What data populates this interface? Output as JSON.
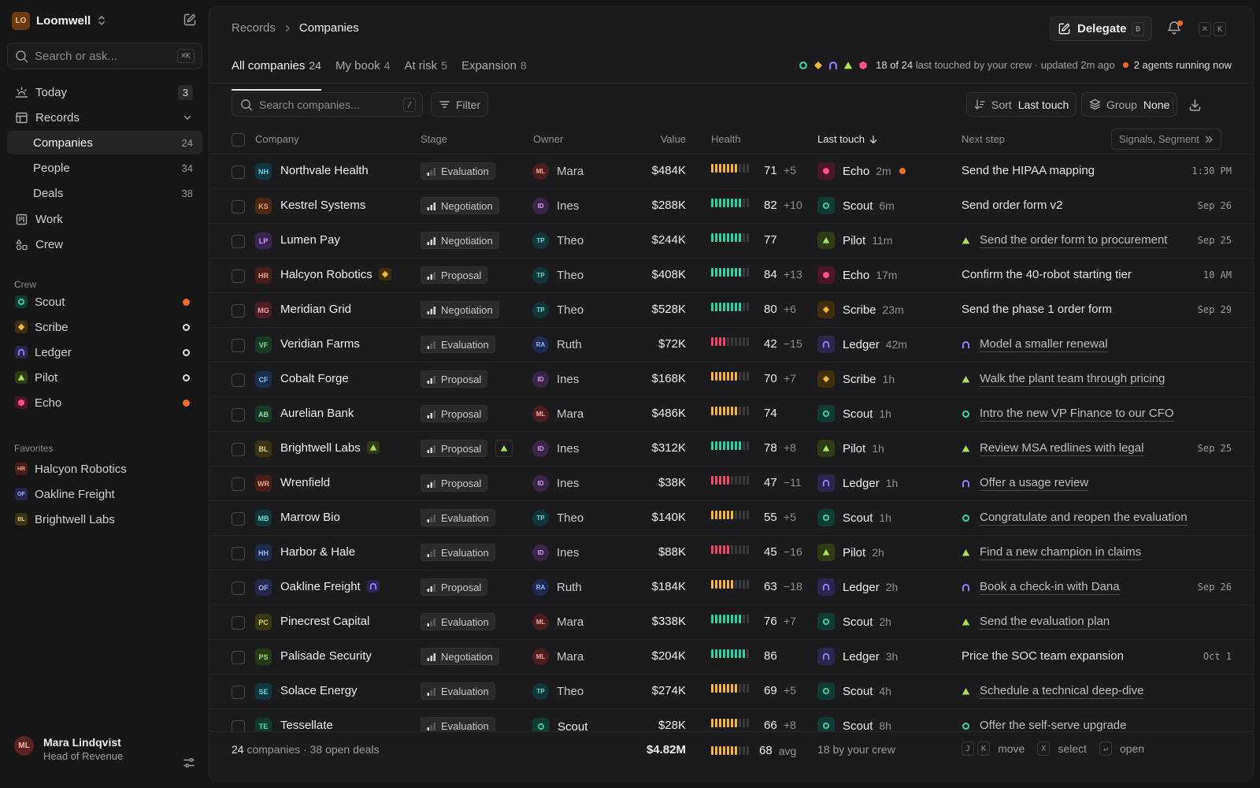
{
  "colors": {
    "scout": "#34d6a8",
    "scribe": "#f5b53a",
    "ledger": "#8f86ff",
    "pilot": "#a8e05a",
    "echo": "#ff4f8b",
    "busy": "#f06a2b",
    "health_high": "#2fd3a4",
    "health_mid": "#f5b53a",
    "health_low": "#f0466b"
  },
  "workspace": {
    "initials": "LO",
    "name": "Loomwell"
  },
  "sidebar": {
    "search_placeholder": "Search or ask...",
    "search_kbd": "⌘K",
    "nav": [
      {
        "label": "Today",
        "count": "3",
        "icon": "sun-icon"
      },
      {
        "label": "Records",
        "icon": "table-icon"
      },
      {
        "label": "Companies",
        "count": "24"
      },
      {
        "label": "People",
        "count": "34"
      },
      {
        "label": "Deals",
        "count": "38"
      },
      {
        "label": "Work",
        "icon": "board-icon"
      },
      {
        "label": "Crew",
        "icon": "shapes-icon"
      }
    ],
    "crew_heading": "Crew",
    "crew": [
      {
        "name": "Scout",
        "status": "busy"
      },
      {
        "name": "Scribe",
        "status": "idle"
      },
      {
        "name": "Ledger",
        "status": "idle"
      },
      {
        "name": "Pilot",
        "status": "idle"
      },
      {
        "name": "Echo",
        "status": "busy"
      }
    ],
    "favorites_heading": "Favorites",
    "favorites": [
      {
        "initials": "HR",
        "name": "Halcyon Robotics"
      },
      {
        "initials": "OF",
        "name": "Oakline Freight"
      },
      {
        "initials": "BL",
        "name": "Brightwell Labs"
      }
    ],
    "user": {
      "initials": "ML",
      "name": "Mara Lindqvist",
      "role": "Head of Revenue"
    }
  },
  "header": {
    "crumb_parent": "Records",
    "crumb_current": "Companies",
    "delegate_label": "Delegate",
    "delegate_kbd": "D",
    "cmd_keys": [
      "⌘",
      "K"
    ]
  },
  "tabs": [
    {
      "label": "All companies",
      "count": "24"
    },
    {
      "label": "My book",
      "count": "4"
    },
    {
      "label": "At risk",
      "count": "5"
    },
    {
      "label": "Expansion",
      "count": "8"
    }
  ],
  "activity": {
    "touched": "18 of 24",
    "touched_rest": "last touched by your crew · updated 2m ago",
    "running": "2 agents running now"
  },
  "toolbar": {
    "search_placeholder": "Search companies...",
    "search_kbd": "/",
    "filter_label": "Filter",
    "sort_label": "Sort",
    "sort_value": "Last touch",
    "group_label": "Group",
    "group_value": "None"
  },
  "columns": {
    "company": "Company",
    "stage": "Stage",
    "owner": "Owner",
    "value": "Value",
    "health": "Health",
    "last_touch": "Last touch",
    "next_step": "Next step",
    "signals": "Signals, Segment"
  },
  "rows": [
    {
      "initials": "NH",
      "company": "Northvale Health",
      "stage": "Evaluation",
      "owner": "Mara",
      "owner_initials": "ML",
      "value": "$484K",
      "health": 71,
      "delta": "+5",
      "agent": "Echo",
      "ago": "2m",
      "live": true,
      "next": "Send the HIPAA mapping",
      "next_agent": "",
      "due": "1:30 PM"
    },
    {
      "initials": "KS",
      "company": "Kestrel Systems",
      "stage": "Negotiation",
      "owner": "Ines",
      "owner_initials": "ID",
      "value": "$288K",
      "health": 82,
      "delta": "+10",
      "agent": "Scout",
      "ago": "6m",
      "next": "Send order form v2",
      "next_agent": "",
      "due": "Sep 26"
    },
    {
      "initials": "LP",
      "company": "Lumen Pay",
      "stage": "Negotiation",
      "owner": "Theo",
      "owner_initials": "TP",
      "value": "$244K",
      "health": 77,
      "delta": "",
      "agent": "Pilot",
      "ago": "11m",
      "next": "Send the order form to procurement",
      "next_agent": "Pilot",
      "due": "Sep 25"
    },
    {
      "initials": "HR",
      "company": "Halcyon Robotics",
      "tag": "Scribe",
      "stage": "Proposal",
      "owner": "Theo",
      "owner_initials": "TP",
      "value": "$408K",
      "health": 84,
      "delta": "+13",
      "agent": "Echo",
      "ago": "17m",
      "next": "Confirm the 40-robot starting tier",
      "next_agent": "",
      "due": "10 AM"
    },
    {
      "initials": "MG",
      "company": "Meridian Grid",
      "stage": "Negotiation",
      "owner": "Theo",
      "owner_initials": "TP",
      "value": "$528K",
      "health": 80,
      "delta": "+6",
      "agent": "Scribe",
      "ago": "23m",
      "next": "Send the phase 1 order form",
      "next_agent": "",
      "due": "Sep 29"
    },
    {
      "initials": "VF",
      "company": "Veridian Farms",
      "stage": "Evaluation",
      "owner": "Ruth",
      "owner_initials": "RA",
      "value": "$72K",
      "health": 42,
      "delta": "−15",
      "agent": "Ledger",
      "ago": "42m",
      "next": "Model a smaller renewal",
      "next_agent": "Ledger",
      "due": ""
    },
    {
      "initials": "CF",
      "company": "Cobalt Forge",
      "stage": "Proposal",
      "owner": "Ines",
      "owner_initials": "ID",
      "value": "$168K",
      "health": 70,
      "delta": "+7",
      "agent": "Scribe",
      "ago": "1h",
      "next": "Walk the plant team through pricing",
      "next_agent": "Pilot",
      "due": ""
    },
    {
      "initials": "AB",
      "company": "Aurelian Bank",
      "stage": "Proposal",
      "owner": "Mara",
      "owner_initials": "ML",
      "value": "$486K",
      "health": 74,
      "delta": "",
      "agent": "Scout",
      "ago": "1h",
      "next": "Intro the new VP Finance to our CFO",
      "next_agent": "Scout",
      "due": ""
    },
    {
      "initials": "BL",
      "company": "Brightwell Labs",
      "tag": "Pilot",
      "stage": "Proposal",
      "stage_tag": "Pilot",
      "owner": "Ines",
      "owner_initials": "ID",
      "value": "$312K",
      "health": 78,
      "delta": "+8",
      "agent": "Pilot",
      "ago": "1h",
      "next": "Review MSA redlines with legal",
      "next_agent": "Pilot",
      "due": "Sep 25"
    },
    {
      "initials": "WR",
      "company": "Wrenfield",
      "stage": "Proposal",
      "owner": "Ines",
      "owner_initials": "ID",
      "value": "$38K",
      "health": 47,
      "delta": "−11",
      "agent": "Ledger",
      "ago": "1h",
      "next": "Offer a usage review",
      "next_agent": "Ledger",
      "due": ""
    },
    {
      "initials": "MB",
      "company": "Marrow Bio",
      "stage": "Evaluation",
      "owner": "Theo",
      "owner_initials": "TP",
      "value": "$140K",
      "health": 55,
      "delta": "+5",
      "agent": "Scout",
      "ago": "1h",
      "next": "Congratulate and reopen the evaluation",
      "next_agent": "Scout",
      "due": ""
    },
    {
      "initials": "HH",
      "company": "Harbor & Hale",
      "stage": "Evaluation",
      "owner": "Ines",
      "owner_initials": "ID",
      "value": "$88K",
      "health": 45,
      "delta": "−16",
      "agent": "Pilot",
      "ago": "2h",
      "next": "Find a new champion in claims",
      "next_agent": "Pilot",
      "due": ""
    },
    {
      "initials": "OF",
      "company": "Oakline Freight",
      "tag": "Ledger",
      "stage": "Proposal",
      "owner": "Ruth",
      "owner_initials": "RA",
      "value": "$184K",
      "health": 63,
      "delta": "−18",
      "agent": "Ledger",
      "ago": "2h",
      "next": "Book a check-in with Dana",
      "next_agent": "Ledger",
      "due": "Sep 26"
    },
    {
      "initials": "PC",
      "company": "Pinecrest Capital",
      "stage": "Evaluation",
      "owner": "Mara",
      "owner_initials": "ML",
      "value": "$338K",
      "health": 76,
      "delta": "+7",
      "agent": "Scout",
      "ago": "2h",
      "next": "Send the evaluation plan",
      "next_agent": "Pilot",
      "due": ""
    },
    {
      "initials": "PS",
      "company": "Palisade Security",
      "stage": "Negotiation",
      "owner": "Mara",
      "owner_initials": "ML",
      "value": "$204K",
      "health": 86,
      "delta": "",
      "agent": "Ledger",
      "ago": "3h",
      "next": "Price the SOC team expansion",
      "next_agent": "",
      "due": "Oct 1"
    },
    {
      "initials": "SE",
      "company": "Solace Energy",
      "stage": "Evaluation",
      "owner": "Theo",
      "owner_initials": "TP",
      "value": "$274K",
      "health": 69,
      "delta": "+5",
      "agent": "Scout",
      "ago": "4h",
      "next": "Schedule a technical deep-dive",
      "next_agent": "Pilot",
      "due": ""
    },
    {
      "initials": "TE",
      "company": "Tessellate",
      "stage": "Evaluation",
      "owner": "Scout",
      "owner_agent": true,
      "value": "$28K",
      "health": 66,
      "delta": "+8",
      "agent": "Scout",
      "ago": "8h",
      "next": "Offer the self-serve upgrade",
      "next_agent": "Scout",
      "due": ""
    }
  ],
  "footer": {
    "companies": "24",
    "companies_label": "companies",
    "deals": "· 38 open deals",
    "total_value": "$4.82M",
    "avg_health": 68,
    "avg_label": "avg",
    "crew_touch": "18 by your crew",
    "hk_move_keys": [
      "J",
      "K"
    ],
    "hk_move": "move",
    "hk_select_key": "X",
    "hk_select": "select",
    "hk_open_key": "↵",
    "hk_open": "open"
  }
}
